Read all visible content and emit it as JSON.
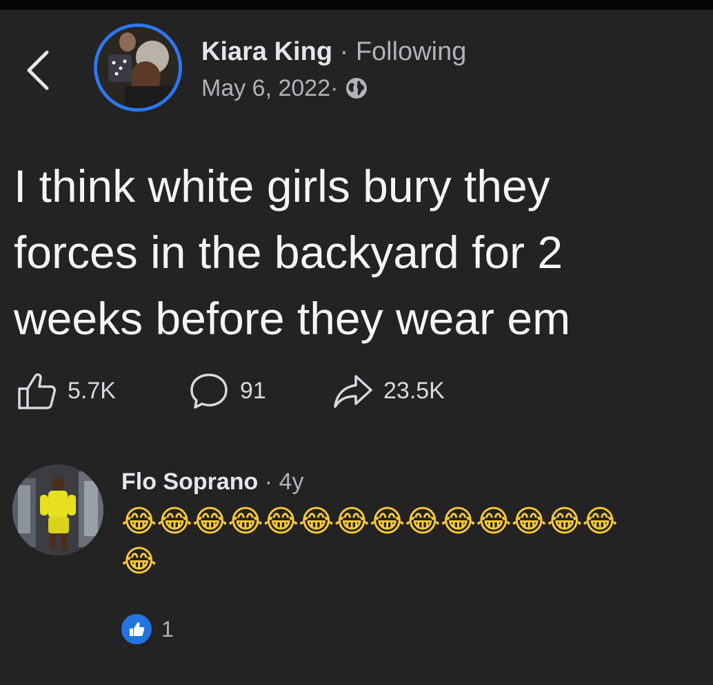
{
  "post": {
    "author": "Kiara King",
    "separator": " · ",
    "follow_status": "Following",
    "date": "May 6, 2022",
    "date_separator": " ·",
    "audience_icon": "globe-icon",
    "text": "I think white girls bury they\nforces in the backyard for 2\nweeks before they wear em"
  },
  "actions": {
    "likes": "5.7K",
    "comments": "91",
    "shares": "23.5K"
  },
  "comment": {
    "author": "Flo Soprano",
    "separator": " · ",
    "time": "4y",
    "text_line1": "😂😂😂😂😂😂😂😂😂😂😂😂😂😂",
    "text_line2": "😂",
    "reaction_count": "1"
  },
  "colors": {
    "background": "#232324",
    "avatar_ring": "#2d76f0",
    "like_badge": "#2374e1",
    "text_primary": "#e4e6eb",
    "text_secondary": "#b0b3b8"
  }
}
